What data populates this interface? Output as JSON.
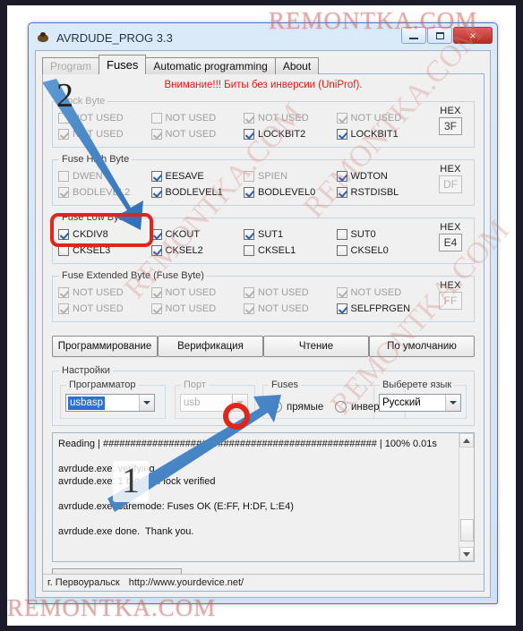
{
  "watermark": {
    "top": "REMONTKA.COM",
    "bottom": "REMONTKA.COM",
    "diagonal": "REMONTKA.COM"
  },
  "window": {
    "title": "AVRDUDE_PROG 3.3",
    "icon": "bug-icon",
    "buttons": {
      "minimize": "minimize-icon",
      "maximize": "maximize-icon",
      "close": "×"
    }
  },
  "tabs": [
    {
      "label": "Program",
      "state": "disabled"
    },
    {
      "label": "Fuses",
      "state": "active"
    },
    {
      "label": "Automatic programming",
      "state": "normal"
    },
    {
      "label": "About",
      "state": "normal"
    }
  ],
  "warning": "Внимание!!! Биты без инверсии (UniProf).",
  "groups": [
    {
      "legend": "Lock Byte",
      "dim": true,
      "hex_label": "HEX",
      "hex_value": "3F",
      "hex_dim": false,
      "checkboxes": [
        {
          "label": "NOT USED",
          "checked": false,
          "disabled": true
        },
        {
          "label": "NOT USED",
          "checked": false,
          "disabled": true
        },
        {
          "label": "NOT USED",
          "checked": true,
          "disabled": true
        },
        {
          "label": "NOT USED",
          "checked": true,
          "disabled": true
        },
        {
          "label": "NOT USED",
          "checked": true,
          "disabled": true
        },
        {
          "label": "NOT USED",
          "checked": true,
          "disabled": true
        },
        {
          "label": "LOCKBIT2",
          "checked": true,
          "disabled": false
        },
        {
          "label": "LOCKBIT1",
          "checked": true,
          "disabled": false
        }
      ]
    },
    {
      "legend": "Fuse High Byte",
      "dim": false,
      "hex_label": "HEX",
      "hex_value": "DF",
      "hex_dim": true,
      "checkboxes": [
        {
          "label": "DWEN",
          "checked": false,
          "disabled": true
        },
        {
          "label": "EESAVE",
          "checked": true,
          "disabled": false
        },
        {
          "label": "SPIEN",
          "checked": false,
          "disabled": true
        },
        {
          "label": "WDTON",
          "checked": true,
          "disabled": false
        },
        {
          "label": "BODLEVEL2",
          "checked": true,
          "disabled": false
        },
        {
          "label": "BODLEVEL1",
          "checked": true,
          "disabled": false
        },
        {
          "label": "BODLEVEL0",
          "checked": true,
          "disabled": false
        },
        {
          "label": "RSTDISBL",
          "checked": true,
          "disabled": false
        }
      ]
    },
    {
      "legend": "Fuse Low Byte",
      "dim": false,
      "hex_label": "HEX",
      "hex_value": "E4",
      "hex_dim": false,
      "checkboxes": [
        {
          "label": "CKDIV8",
          "checked": true,
          "disabled": false
        },
        {
          "label": "CKOUT",
          "checked": true,
          "disabled": false
        },
        {
          "label": "SUT1",
          "checked": true,
          "disabled": false
        },
        {
          "label": "SUT0",
          "checked": false,
          "disabled": false
        },
        {
          "label": "CKSEL3",
          "checked": false,
          "disabled": false
        },
        {
          "label": "CKSEL2",
          "checked": true,
          "disabled": false
        },
        {
          "label": "CKSEL1",
          "checked": false,
          "disabled": false
        },
        {
          "label": "CKSEL0",
          "checked": false,
          "disabled": false
        }
      ]
    },
    {
      "legend": "Fuse Extended Byte (Fuse Byte)",
      "dim": false,
      "hex_label": "HEX",
      "hex_value": "FF",
      "hex_dim": true,
      "checkboxes": [
        {
          "label": "NOT USED",
          "checked": true,
          "disabled": true
        },
        {
          "label": "NOT USED",
          "checked": true,
          "disabled": true
        },
        {
          "label": "NOT USED",
          "checked": true,
          "disabled": true
        },
        {
          "label": "NOT USED",
          "checked": true,
          "disabled": true
        },
        {
          "label": "NOT USED",
          "checked": true,
          "disabled": true
        },
        {
          "label": "NOT USED",
          "checked": true,
          "disabled": true
        },
        {
          "label": "NOT USED",
          "checked": true,
          "disabled": true
        },
        {
          "label": "SELFPRGEN",
          "checked": true,
          "disabled": false
        }
      ]
    }
  ],
  "actions": [
    "Программирование",
    "Верификация",
    "Чтение",
    "По умолчанию"
  ],
  "settings": {
    "legend": "Настройки",
    "programmer": {
      "legend": "Программатор",
      "value": "usbasp",
      "selected": true
    },
    "port": {
      "legend": "Порт",
      "value": "usb",
      "disabled": true
    },
    "fuses": {
      "legend": "Fuses",
      "options": [
        {
          "label": "прямые",
          "selected": true
        },
        {
          "label": "инверсные",
          "selected": false
        }
      ]
    },
    "language": {
      "legend": "Выберете язык",
      "value": "Русский"
    }
  },
  "log": "Reading | ################################################## | 100% 0.01s\n\navrdude.exe: verifying .\navrdude.exe: 1 bytes of lock verified\n\navrdude.exe: saremode: Fuses OK (E:FF, H:DF, L:E4)\n\navrdude.exe done.  Thank you.",
  "statusbar": {
    "city": "г. Первоуральск",
    "url": "http://www.yourdevice.net/"
  },
  "annotations": {
    "step_two": "2",
    "step_one": "1",
    "highlight_color": "#e0261c",
    "arrow_color": "#3a7bbf"
  }
}
